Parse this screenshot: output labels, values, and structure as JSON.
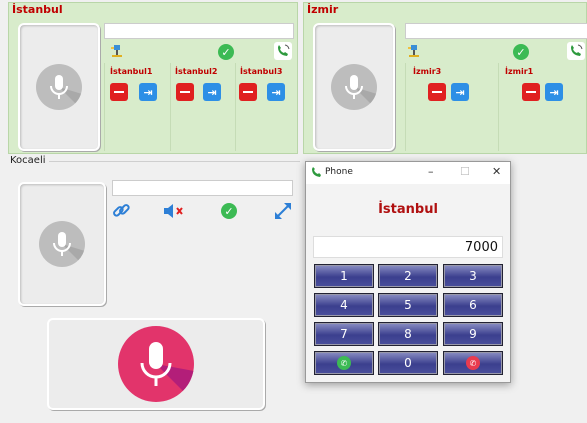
{
  "groups": {
    "istanbul": {
      "title": "İstanbul",
      "lines": [
        "İstanbul1",
        "İstanbul2",
        "İstanbul3"
      ]
    },
    "izmir": {
      "title": "İzmir",
      "lines": [
        "İzmir3",
        "İzmir1"
      ]
    }
  },
  "kocaeli": {
    "title": "Kocaeli"
  },
  "phone": {
    "window_title": "Phone",
    "city": "İstanbul",
    "display": "7000",
    "keys": [
      "1",
      "2",
      "3",
      "4",
      "5",
      "6",
      "7",
      "8",
      "9",
      "0"
    ]
  },
  "colors": {
    "group_bg": "#d8eccb",
    "accent_red": "#c00000",
    "mic_pink": "#e2346b",
    "key_blue": "#3b3f8e",
    "check_green": "#3cba54"
  }
}
